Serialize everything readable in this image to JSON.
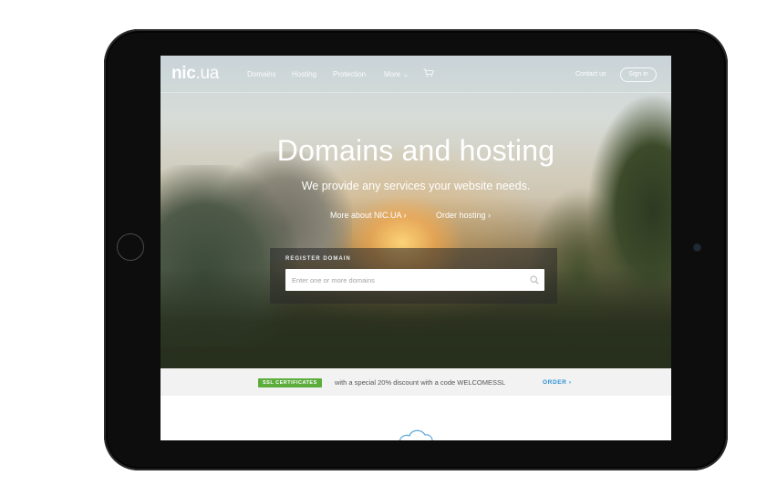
{
  "nav": {
    "logo_bold": "nic",
    "logo_rest": ".ua",
    "items": [
      "Domains",
      "Hosting",
      "Protection",
      "More ⌄"
    ],
    "cart_icon": "cart-icon",
    "contact": "Contact us",
    "signin": "Sign in"
  },
  "hero": {
    "title": "Domains and hosting",
    "subtitle": "We provide any services your website needs.",
    "link_about": "More about NIC.UA ›",
    "link_hosting": "Order hosting ›"
  },
  "register": {
    "label": "REGISTER DOMAIN",
    "placeholder": "Enter one or more domains",
    "search_icon": "search-icon"
  },
  "promo": {
    "badge": "SSL CERTIFICATES",
    "text": "with a special 20% discount with a code WELCOMESSL",
    "order": "ORDER ›",
    "badge_color": "#5cad3b",
    "link_color": "#2c8fd6"
  }
}
